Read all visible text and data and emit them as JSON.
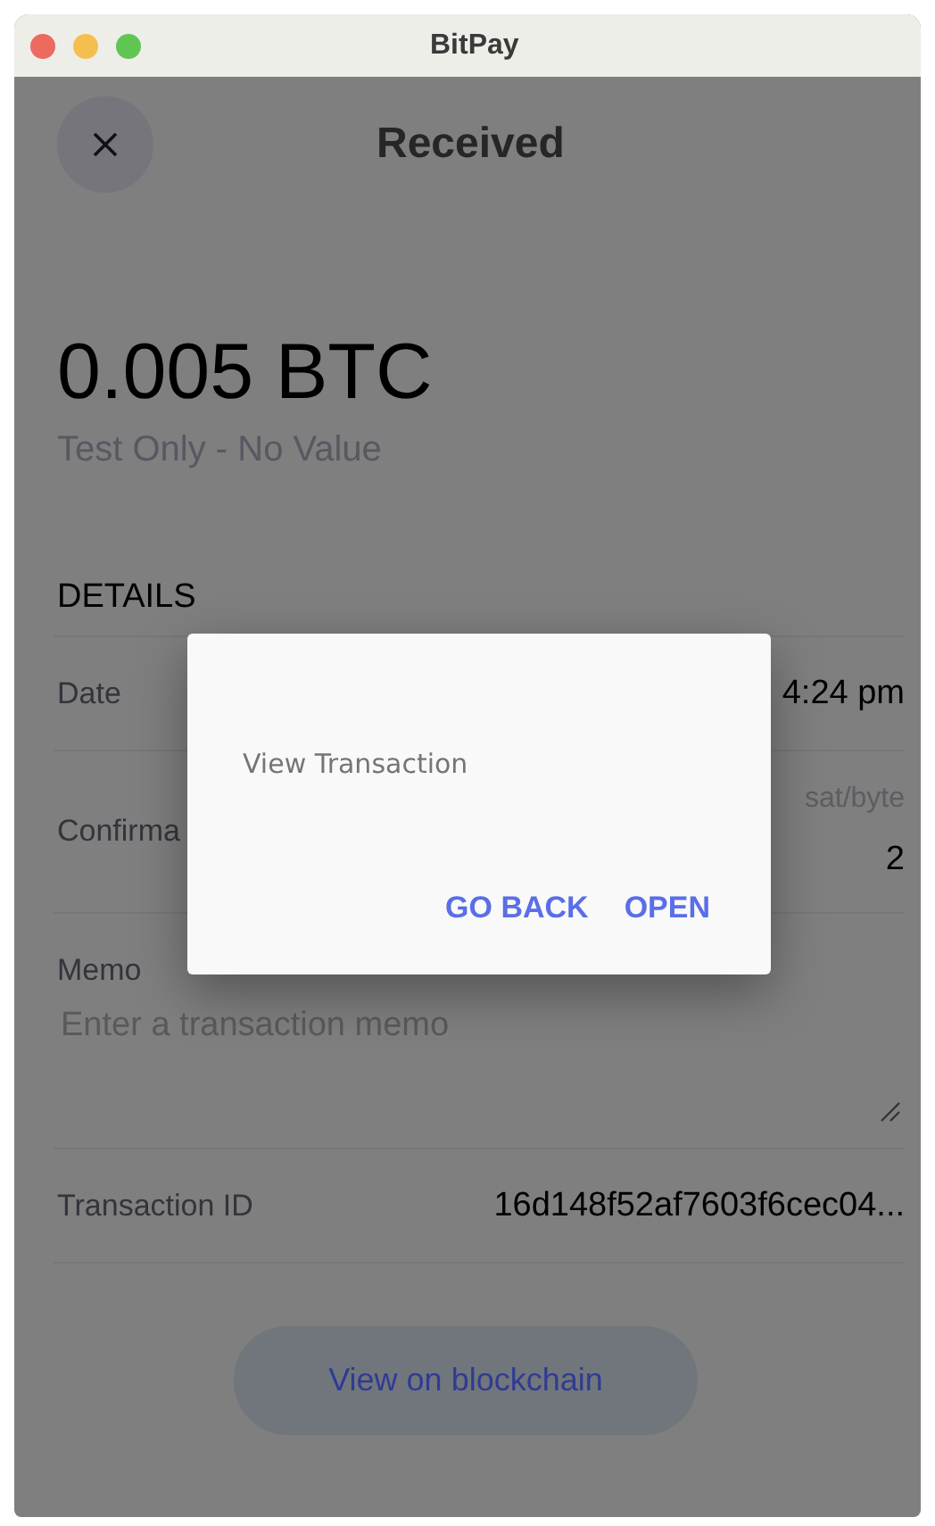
{
  "window": {
    "title": "BitPay"
  },
  "header": {
    "title": "Received"
  },
  "amount": "0.005 BTC",
  "network_note": "Test Only - No Value",
  "details": {
    "heading": "DETAILS",
    "rows": [
      {
        "kind": "value",
        "label": "Date",
        "value": "4:24 pm"
      },
      {
        "kind": "fee",
        "label": "Confirma",
        "note": "sat/byte",
        "value": "2"
      },
      {
        "kind": "memo",
        "label": "Memo",
        "placeholder": "Enter a transaction memo"
      },
      {
        "kind": "value",
        "label": "Transaction ID",
        "value": "16d148f52af7603f6cec04..."
      }
    ]
  },
  "blockchain_button": "View on blockchain",
  "dialog": {
    "message": "View Transaction",
    "buttons": [
      "GO BACK",
      "OPEN"
    ]
  }
}
